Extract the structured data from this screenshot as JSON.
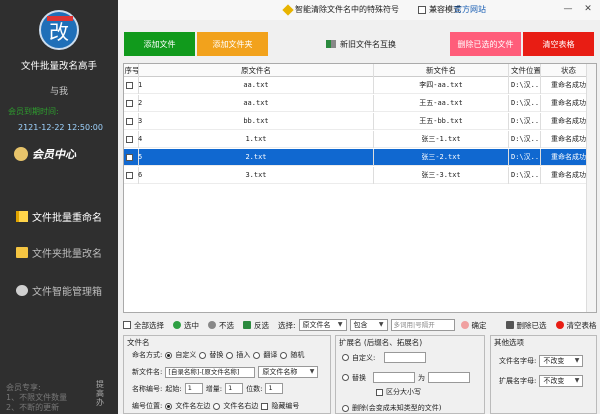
{
  "sidebar": {
    "logo_char": "改",
    "app_name": "文件批量改名高手",
    "sub_name": "与我",
    "expire_label": "会员到期时间:",
    "expire_time": "2121-12-22 12:50:00",
    "member_center": "会员中心",
    "nav": [
      {
        "label": "文件批量重命名",
        "active": true
      },
      {
        "label": "文件夹批量改名",
        "active": false
      },
      {
        "label": "文件智能管理箱",
        "active": false
      }
    ],
    "tip_lines": [
      "会员专享:",
      "1、不限文件数量",
      "2、不断的更新"
    ],
    "tip_side": "提高办"
  },
  "topbar": {
    "special_chars": "智能清除文件名中的特殊符号",
    "compat_mode": "兼容模式",
    "official_site": "官方网站",
    "minimize": "—",
    "close": "✕"
  },
  "actions": {
    "add_file": "添加文件",
    "add_folder": "添加文件夹",
    "swap_names": "新旧文件名互换",
    "delete_selected": "删除已选的文件",
    "clear_table": "清空表格"
  },
  "table": {
    "headers": [
      "序号",
      "原文件名",
      "新文件名",
      "文件位置",
      "状态"
    ],
    "rows": [
      {
        "seq": "1",
        "orig": "aa.txt",
        "new": "李四-aa.txt",
        "loc": "D:\\汉...",
        "status": "重命名成功",
        "selected": false
      },
      {
        "seq": "2",
        "orig": "aa.txt",
        "new": "王五-aa.txt",
        "loc": "D:\\汉...",
        "status": "重命名成功",
        "selected": false
      },
      {
        "seq": "3",
        "orig": "bb.txt",
        "new": "王五-bb.txt",
        "loc": "D:\\汉...",
        "status": "重命名成功",
        "selected": false
      },
      {
        "seq": "4",
        "orig": "1.txt",
        "new": "张三-1.txt",
        "loc": "D:\\汉...",
        "status": "重命名成功",
        "selected": false
      },
      {
        "seq": "5",
        "orig": "2.txt",
        "new": "张三-2.txt",
        "loc": "D:\\汉...",
        "status": "重命名成功",
        "selected": true
      },
      {
        "seq": "6",
        "orig": "3.txt",
        "new": "张三-3.txt",
        "loc": "D:\\汉...",
        "status": "重命名成功",
        "selected": false
      }
    ]
  },
  "toolbar": {
    "select_all": "全部选择",
    "select": "选中",
    "deselect": "不选",
    "invert": "反选",
    "choose_label": "选择:",
    "field_select": "原文件名",
    "match_select": "包含",
    "search_placeholder": "多词用|号隔开",
    "confirm": "确定",
    "delete_selected": "删除已选",
    "clear_table": "清空表格"
  },
  "file_panel": {
    "title": "文件名",
    "naming_label": "命名方式:",
    "naming_options": [
      "自定义",
      "替换",
      "插入",
      "翻译",
      "随机"
    ],
    "new_name_label": "新文件名:",
    "new_name_value": "[自录名称]-[原文件名称]",
    "new_name_select": "原文件名称",
    "number_label": "名称编号:",
    "start_label": "起始:",
    "start_value": "1",
    "step_label": "增量:",
    "step_value": "1",
    "digits_label": "位数:",
    "digits_value": "1",
    "position_label": "编号位置:",
    "position_left": "文件名左边",
    "position_right": "文件名右边",
    "hide_number": "隐藏编号"
  },
  "ext_panel": {
    "title": "扩展名 (后缀名、拓展名)",
    "custom_label": "自定义:",
    "replace_label": "替换",
    "replace_to": "为",
    "case_label": "区分大小写",
    "delete_label": "删除(会变成未知类型的文件)"
  },
  "other_panel": {
    "title": "其他选项",
    "filename_case_label": "文件名字母:",
    "filename_case_value": "不改变",
    "ext_case_label": "扩展名字母:",
    "ext_case_value": "不改变"
  }
}
